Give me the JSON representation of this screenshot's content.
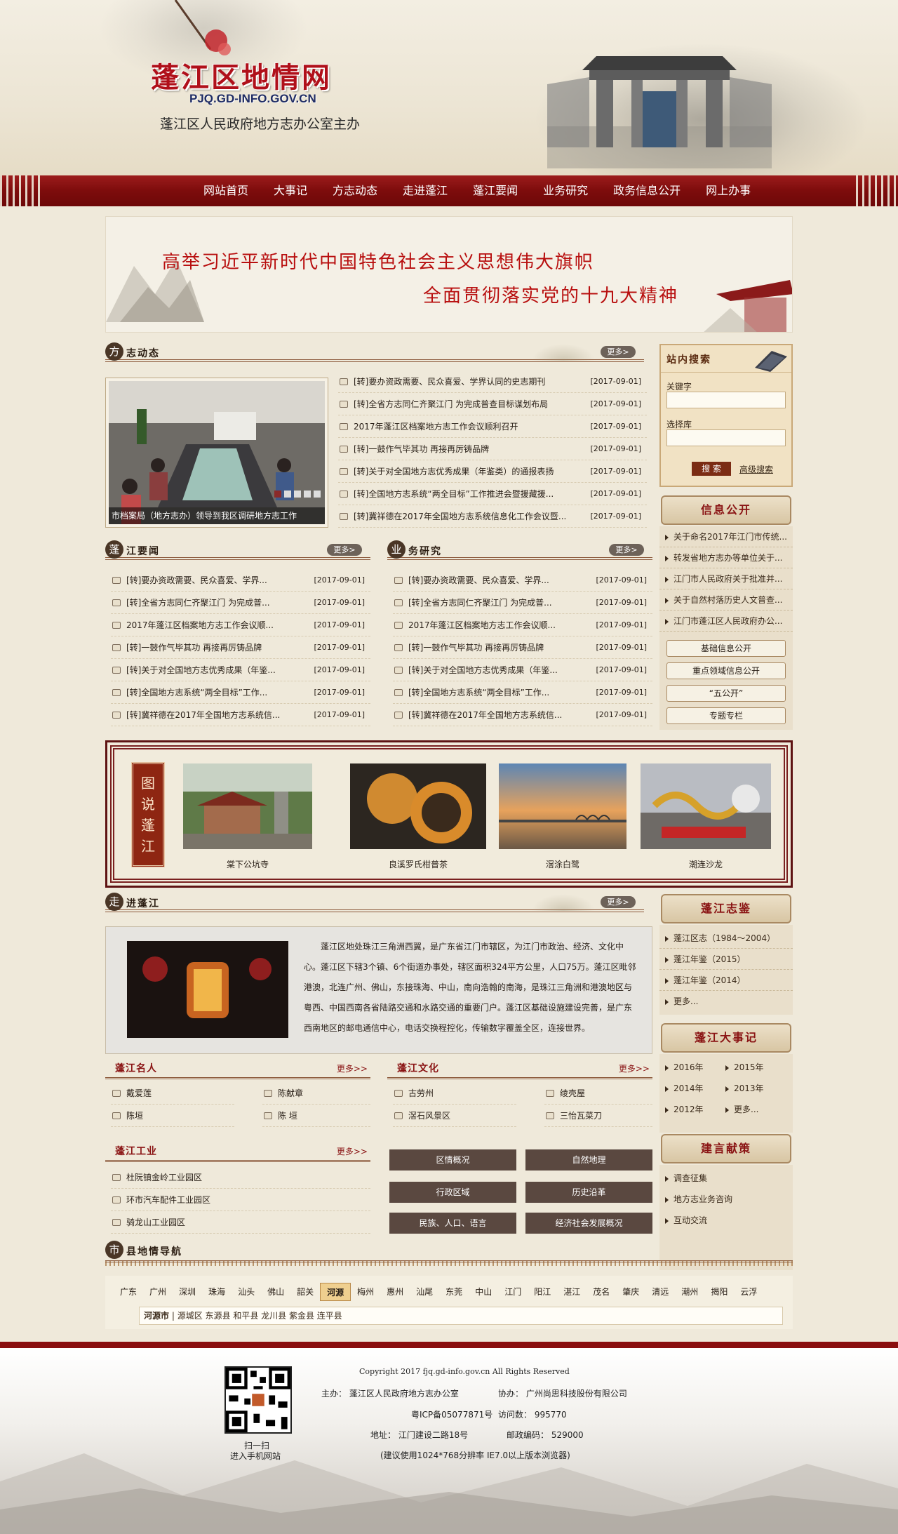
{
  "header": {
    "logo_text": "蓬江区地情网",
    "domain": "PJQ.GD-INFO.GOV.CN",
    "host": "蓬江区人民政府地方志办公室主办"
  },
  "nav": [
    "网站首页",
    "大事记",
    "方志动态",
    "走进蓬江",
    "蓬江要闻",
    "业务研究",
    "政务信息公开",
    "网上办事"
  ],
  "banner": {
    "line1": "高举习近平新时代中国特色社会主义思想伟大旗帜",
    "line2": "全面贯彻落实党的十九大精神"
  },
  "more_label": "更多>",
  "fzdt": {
    "seal": "方",
    "title": "志动态",
    "photo_caption": "市档案局（地方志办）领导到我区调研地方志工作",
    "items": [
      {
        "t": "[转]要办资政需要、民众喜爱、学界认同的史志期刊",
        "d": "[2017-09-01]"
      },
      {
        "t": "[转]全省方志同仁齐聚江门 为完成普查目标谋划布局",
        "d": "[2017-09-01]"
      },
      {
        "t": "2017年蓬江区档案地方志工作会议顺利召开",
        "d": "[2017-09-01]"
      },
      {
        "t": "[转]一鼓作气毕其功 再接再厉铸品牌",
        "d": "[2017-09-01]"
      },
      {
        "t": "[转]关于对全国地方志优秀成果（年鉴类）的通报表扬",
        "d": "[2017-09-01]"
      },
      {
        "t": "[转]全国地方志系统“两全目标”工作推进会暨援藏援...",
        "d": "[2017-09-01]"
      },
      {
        "t": "[转]冀祥德在2017年全国地方志系统信息化工作会议暨...",
        "d": "[2017-09-01]"
      }
    ]
  },
  "pjyw": {
    "seal": "蓬",
    "title": "江要闻",
    "items": [
      {
        "t": "[转]要办资政需要、民众喜爱、学界...",
        "d": "[2017-09-01]"
      },
      {
        "t": "[转]全省方志同仁齐聚江门 为完成普...",
        "d": "[2017-09-01]"
      },
      {
        "t": "2017年蓬江区档案地方志工作会议顺...",
        "d": "[2017-09-01]"
      },
      {
        "t": "[转]一鼓作气毕其功 再接再厉铸品牌",
        "d": "[2017-09-01]"
      },
      {
        "t": "[转]关于对全国地方志优秀成果（年鉴...",
        "d": "[2017-09-01]"
      },
      {
        "t": "[转]全国地方志系统“两全目标”工作...",
        "d": "[2017-09-01]"
      },
      {
        "t": "[转]冀祥德在2017年全国地方志系统信...",
        "d": "[2017-09-01]"
      }
    ]
  },
  "ywyj": {
    "seal": "业",
    "title": "务研究",
    "items": [
      {
        "t": "[转]要办资政需要、民众喜爱、学界...",
        "d": "[2017-09-01]"
      },
      {
        "t": "[转]全省方志同仁齐聚江门 为完成普...",
        "d": "[2017-09-01]"
      },
      {
        "t": "2017年蓬江区档案地方志工作会议顺...",
        "d": "[2017-09-01]"
      },
      {
        "t": "[转]一鼓作气毕其功 再接再厉铸品牌",
        "d": "[2017-09-01]"
      },
      {
        "t": "[转]关于对全国地方志优秀成果（年鉴...",
        "d": "[2017-09-01]"
      },
      {
        "t": "[转]全国地方志系统“两全目标”工作...",
        "d": "[2017-09-01]"
      },
      {
        "t": "[转]冀祥德在2017年全国地方志系统信...",
        "d": "[2017-09-01]"
      }
    ]
  },
  "search": {
    "title": "站内搜索",
    "keyword_label": "关键字",
    "db_label": "选择库",
    "search_btn": "搜 索",
    "advanced": "高级搜索"
  },
  "xxgk": {
    "title": "信息公开",
    "items": [
      "关于命名2017年江门市传统...",
      "转发省地方志办等单位关于...",
      "江门市人民政府关于批准并...",
      "关于自然村落历史人文普查...",
      "江门市蓬江区人民政府办公..."
    ],
    "buttons": [
      "基础信息公开",
      "重点领域信息公开",
      "“五公开”",
      "专题专栏"
    ]
  },
  "tspj": {
    "vtitle": "图说蓬江",
    "items": [
      "棠下公坑寺",
      "良溪罗氏柑普茶",
      "滘涂白鹭",
      "潮连沙龙"
    ]
  },
  "zjpj": {
    "seal": "走",
    "title": "进蓬江",
    "text": "蓬江区地处珠江三角洲西翼，是广东省江门市辖区，为江门市政治、经济、文化中心。蓬江区下辖3个镇、6个街道办事处，辖区面积324平方公里，人口75万。蓬江区毗邻港澳，北连广州、佛山，东接珠海、中山，南向浩翰的南海，是珠江三角洲和港澳地区与粤西、中国西南各省陆路交通和水路交通的重要门户。蓬江区基础设施建设完善，是广东西南地区的邮电通信中心，电话交换程控化，传输数字覆盖全区，连接世界。"
  },
  "pjzj": {
    "title": "蓬江志鉴",
    "items": [
      "蓬江区志（1984～2004）",
      "蓬江年鉴（2015）",
      "蓬江年鉴（2014）",
      "更多..."
    ]
  },
  "pjdsj": {
    "title": "蓬江大事记",
    "items": [
      "2016年",
      "2015年",
      "2014年",
      "2013年",
      "2012年",
      "更多..."
    ]
  },
  "jyxc": {
    "title": "建言献策",
    "items": [
      "调查征集",
      "地方志业务咨询",
      "互动交流"
    ]
  },
  "pjmr": {
    "title": "蓬江名人",
    "more": "更多>>",
    "items": [
      "戴爱莲",
      "陈献章",
      "陈垣",
      "陈 垣"
    ]
  },
  "pjwh": {
    "title": "蓬江文化",
    "more": "更多>>",
    "items": [
      "古劳州",
      "绫壳屋",
      "滘石风景区",
      "三怡瓦菜刀"
    ]
  },
  "pjgy": {
    "title": "蓬江工业",
    "more": "更多>>",
    "items": [
      "杜阮镇金岭工业园区",
      "环市汽车配件工业园区",
      "骑龙山工业园区"
    ]
  },
  "quick_btns": [
    "区情概况",
    "自然地理",
    "行政区域",
    "历史沿革",
    "民族、人口、语言",
    "经济社会发展概况"
  ],
  "county_nav": {
    "seal": "市",
    "title": "县地情导航",
    "cities": [
      "广东",
      "广州",
      "深圳",
      "珠海",
      "汕头",
      "佛山",
      "韶关",
      "河源",
      "梅州",
      "惠州",
      "汕尾",
      "东莞",
      "中山",
      "江门",
      "阳江",
      "湛江",
      "茂名",
      "肇庆",
      "清远",
      "潮州",
      "揭阳",
      "云浮"
    ],
    "active": "河源",
    "sub_city": "河源市",
    "sub_list": "| 源城区 东源县 和平县 龙川县 紫金县 连平县"
  },
  "footer": {
    "copyright": "Copyright 2017 fjq.gd-info.gov.cn  All Rights Reserved",
    "host": "主办：  蓬江区人民政府地方志办公室",
    "support": "协办：  广州尚思科技股份有限公司",
    "icp": "粤ICP备05077871号",
    "visits_label": "访问数：",
    "visits": "995770",
    "address": "地址：  江门建设二路18号",
    "postcode": "邮政编码：  529000",
    "tip": "(建议使用1024*768分辨率 IE7.0以上版本浏览器)",
    "qr_caption1": "扫一扫",
    "qr_caption2": "进入手机网站"
  }
}
